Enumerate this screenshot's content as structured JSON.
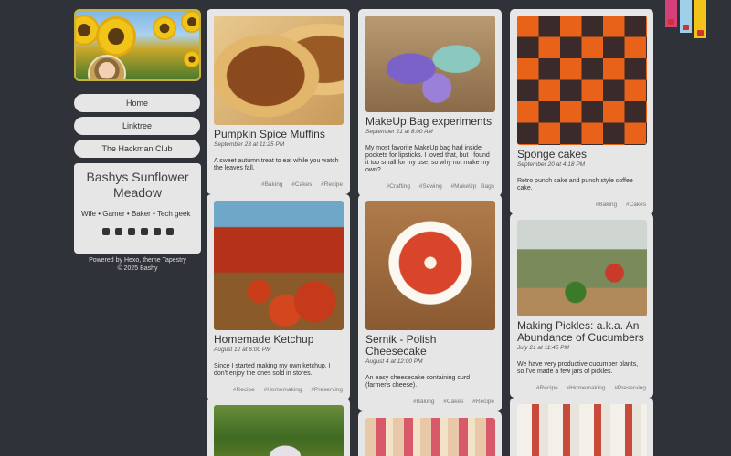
{
  "sidebar": {
    "nav": [
      {
        "label": "Home"
      },
      {
        "label": "Linktree"
      },
      {
        "label": "The Hackman Club"
      }
    ],
    "about": {
      "title": "Bashys Sunflower Meadow",
      "tagline": "Wife • Gamer • Baker • Tech geek",
      "socials": [
        "mastodon-icon",
        "instagram-icon",
        "discord-icon",
        "linkedin-icon",
        "paypal-icon",
        "rss-icon"
      ]
    },
    "footer": {
      "line1": "Powered by Hexo, theme Tapestry",
      "line2": "© 2025 Bashy"
    }
  },
  "posts": [
    {
      "title": "Pumpkin Spice Muffins",
      "date": "September 23 at 11:25 PM",
      "desc": "A sweet autumn treat to eat while you watch the leaves fall.",
      "tags": [
        "#Baking",
        "#Cakes",
        "#Recipe"
      ],
      "image": "muffins-image"
    },
    {
      "title": "MakeUp Bag experiments",
      "date": "September 21 at 8:00 AM",
      "desc": "My most favorite MakeUp bag had inside pockets for lipsticks. I loved that, but I found it too small for my use, so why not make my own?",
      "tags": [
        "#Crafting",
        "#Sewing",
        "#MakeUp Bags"
      ],
      "image": "makeup-bags-image"
    },
    {
      "title": "Sponge cakes",
      "date": "September 20 at 4:18 PM",
      "desc": "Retro punch cake and punch style coffee cake.",
      "tags": [
        "#Baking",
        "#Cakes"
      ],
      "image": "sponge-cakes-image"
    },
    {
      "title": "Homemade Ketchup",
      "date": "August 12 at 6:00 PM",
      "desc": "Since I started making my own ketchup, I don't enjoy the ones sold in stores.",
      "tags": [
        "#Recipe",
        "#Homemaking",
        "#Preserving"
      ],
      "image": "ketchup-image"
    },
    {
      "title": "Sernik - Polish Cheesecake",
      "date": "August 4 at 12:00 PM",
      "desc": "An easy cheesecake containing curd (farmer's cheese).",
      "tags": [
        "#Baking",
        "#Cakes",
        "#Recipe"
      ],
      "image": "cheesecake-image"
    },
    {
      "title": "Making Pickles: a.k.a. An Abundance of Cucumbers",
      "date": "July 21 at 11:45 PM",
      "desc": "We have very productive cucumber plants, so I've made a few jars of pickles.",
      "tags": [
        "#Recipe",
        "#Homemaking",
        "#Preserving"
      ],
      "image": "pickles-image"
    }
  ]
}
